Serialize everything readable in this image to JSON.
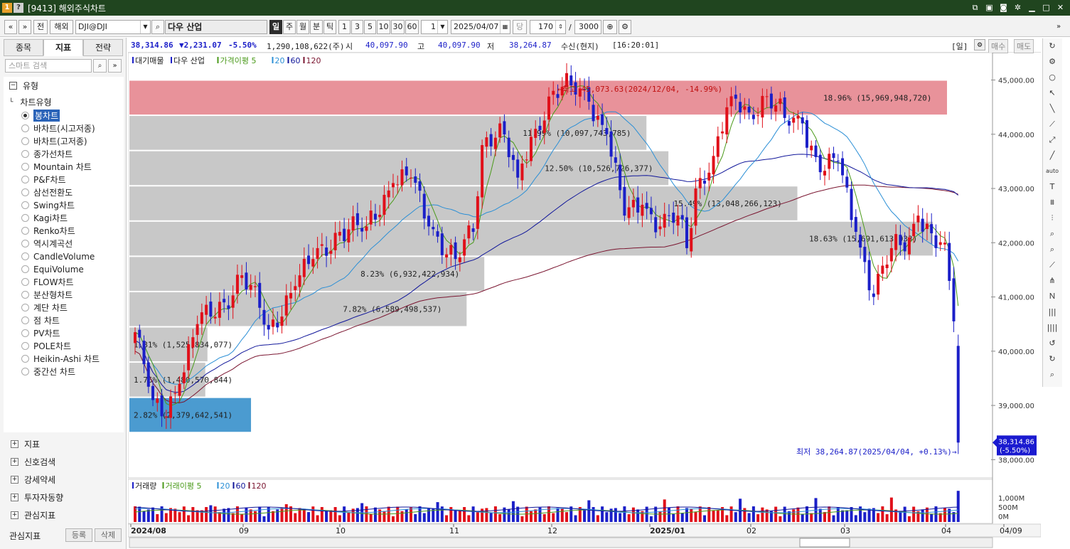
{
  "window": {
    "title": "[9413] 해외주식차트",
    "icon_a": "1",
    "icon_b": "?"
  },
  "toolbar": {
    "nav_prev": "«",
    "nav_down": "»",
    "btn_all": "전",
    "market": "해외",
    "symbol": "DJI@DJI",
    "name": "다우 산업",
    "periods": [
      "일",
      "주",
      "월",
      "분",
      "틱"
    ],
    "intervals": [
      "1",
      "3",
      "5",
      "10",
      "30",
      "60"
    ],
    "unit_value": "1",
    "date": "2025/04/07",
    "dang": "당",
    "count": "170",
    "slash": "/",
    "total": "3000"
  },
  "leftpanel": {
    "tabs": [
      "종목",
      "지표",
      "전략"
    ],
    "active_tab": "지표",
    "search_placeholder": "스마트 검색",
    "tree_root": "유형",
    "chart_type_group": "차트유형",
    "chart_types": [
      "봉차트",
      "바차트(시고저종)",
      "바차트(고저종)",
      "종가선차트",
      "Mountain 차트",
      "P&F차트",
      "삼선전환도",
      "Swing차트",
      "Kagi차트",
      "Renko차트",
      "역시계곡선",
      "CandleVolume",
      "EquiVolume",
      "FLOW차트",
      "분산형차트",
      "계단 차트",
      "점 차트",
      "PV차트",
      "POLE차트",
      "Heikin-Ashi 차트",
      "중간선 차트"
    ],
    "selected_type": "봉차트",
    "sections": [
      "지표",
      "신호검색",
      "강세약세",
      "투자자동향",
      "관심지표"
    ],
    "bottom_label": "관심지표",
    "bottom_buttons": [
      "등록",
      "삭제"
    ]
  },
  "infobar": {
    "price": "38,314.86",
    "change": "▼2,231.07",
    "pct": "-5.50%",
    "volume": "1,290,108,622(주)",
    "open_label": "시",
    "open": "40,097.90",
    "high_label": "고",
    "high": "40,097.90",
    "low_label": "저",
    "low": "38,264.87",
    "status": "수신(현지)",
    "time": "[16:20:01]",
    "period_tag": "[일]",
    "buy": "매수",
    "sell": "매도"
  },
  "legend": {
    "price_pane": [
      "대기매물",
      "다우 산업",
      "가격이평 5",
      "20",
      "60",
      "120"
    ],
    "volume_pane": [
      "거래량",
      "거래이평 5",
      "20",
      "60",
      "120"
    ]
  },
  "colors": {
    "up": "#e0101a",
    "down": "#1b1fc8",
    "ma5": "#4a9a1a",
    "ma20": "#2b8fd6",
    "ma60": "#10169a",
    "ma120": "#7a1530",
    "vp_grey": "#c8c8c8",
    "vp_red": "#e8929a",
    "vp_blue": "#4b9bd0",
    "accent": "#2a63b8",
    "title_bg": "#20451f"
  },
  "annotations": {
    "high": "←최고 45,073.63(2024/12/04, -14.99%)",
    "low": "최저 38,264.87(2025/04/04, +0.13%)→",
    "last_price": "38,314.86",
    "last_pct": "(-5.50%)"
  },
  "chart_data": {
    "type": "candlestick",
    "y_axis": {
      "min": 37900,
      "max": 45400,
      "ticks": [
        38000,
        39000,
        40000,
        41000,
        42000,
        43000,
        44000,
        45000
      ],
      "tick_labels": [
        "38,000.00",
        "39,000.00",
        "40,000.00",
        "41,000.00",
        "42,000.00",
        "43,000.00",
        "44,000.00",
        "45,000.00"
      ]
    },
    "x_axis_labels": [
      "2024/08",
      "09",
      "10",
      "11",
      "12",
      "2025/01",
      "02",
      "03",
      "04",
      "04/09"
    ],
    "volume_axis": {
      "tick_labels": [
        "1,000M",
        "500M",
        "0M"
      ]
    },
    "volume_profile": [
      {
        "label": "2.82% (2,379,642,541)",
        "low": 38500,
        "high": 39150,
        "pct": 2.82,
        "color": "blue"
      },
      {
        "label": "1.76% (1,480,570,844)",
        "low": 39150,
        "high": 39800,
        "pct": 1.76,
        "color": "grey"
      },
      {
        "label": "1.81% (1,525,834,077)",
        "low": 39800,
        "high": 40450,
        "pct": 1.81,
        "color": "grey"
      },
      {
        "label": "7.82% (6,589,498,537)",
        "low": 40450,
        "high": 41100,
        "pct": 7.82,
        "color": "grey"
      },
      {
        "label": "8.23% (6,932,422,934)",
        "low": 41100,
        "high": 41750,
        "pct": 8.23,
        "color": "grey"
      },
      {
        "label": "18.63% (15,691,613,933)",
        "low": 41750,
        "high": 42400,
        "pct": 18.63,
        "color": "grey"
      },
      {
        "label": "15.49% (13,048,266,123)",
        "low": 42400,
        "high": 43050,
        "pct": 15.49,
        "color": "grey"
      },
      {
        "label": "12.50% (10,526,726,377)",
        "low": 43050,
        "high": 43700,
        "pct": 12.5,
        "color": "grey"
      },
      {
        "label": "11.99% (10,097,743,785)",
        "low": 43700,
        "high": 44350,
        "pct": 11.99,
        "color": "grey"
      },
      {
        "label": "18.96% (15,969,948,720)",
        "low": 44350,
        "high": 45000,
        "pct": 18.96,
        "color": "red"
      }
    ],
    "keypoints": [
      {
        "i": 0,
        "c": 40350
      },
      {
        "i": 4,
        "c": 39100
      },
      {
        "i": 6,
        "c": 38800
      },
      {
        "i": 10,
        "c": 39400
      },
      {
        "i": 14,
        "c": 40500
      },
      {
        "i": 20,
        "c": 40900
      },
      {
        "i": 24,
        "c": 41400
      },
      {
        "i": 28,
        "c": 40800
      },
      {
        "i": 30,
        "c": 40400
      },
      {
        "i": 36,
        "c": 41200
      },
      {
        "i": 40,
        "c": 41700
      },
      {
        "i": 46,
        "c": 42200
      },
      {
        "i": 52,
        "c": 42300
      },
      {
        "i": 58,
        "c": 43100
      },
      {
        "i": 62,
        "c": 43200
      },
      {
        "i": 66,
        "c": 42300
      },
      {
        "i": 72,
        "c": 41700
      },
      {
        "i": 76,
        "c": 42200
      },
      {
        "i": 78,
        "c": 43800
      },
      {
        "i": 82,
        "c": 44200
      },
      {
        "i": 86,
        "c": 43200
      },
      {
        "i": 90,
        "c": 44100
      },
      {
        "i": 94,
        "c": 44800
      },
      {
        "i": 98,
        "c": 44900
      },
      {
        "i": 102,
        "c": 44600
      },
      {
        "i": 106,
        "c": 44000
      },
      {
        "i": 110,
        "c": 42500
      },
      {
        "i": 114,
        "c": 42700
      },
      {
        "i": 118,
        "c": 42300
      },
      {
        "i": 122,
        "c": 42500
      },
      {
        "i": 124,
        "c": 41900
      },
      {
        "i": 126,
        "c": 43000
      },
      {
        "i": 130,
        "c": 43600
      },
      {
        "i": 134,
        "c": 44700
      },
      {
        "i": 138,
        "c": 44400
      },
      {
        "i": 142,
        "c": 44700
      },
      {
        "i": 146,
        "c": 44300
      },
      {
        "i": 150,
        "c": 44200
      },
      {
        "i": 154,
        "c": 43300
      },
      {
        "i": 158,
        "c": 43500
      },
      {
        "i": 162,
        "c": 42200
      },
      {
        "i": 166,
        "c": 41000
      },
      {
        "i": 170,
        "c": 41900
      },
      {
        "i": 174,
        "c": 42100
      },
      {
        "i": 176,
        "c": 42500
      },
      {
        "i": 180,
        "c": 41900
      },
      {
        "i": 182,
        "c": 42000
      },
      {
        "i": 184,
        "c": 40550
      },
      {
        "i": 185,
        "c": 38315
      }
    ],
    "candle_count": 186
  }
}
